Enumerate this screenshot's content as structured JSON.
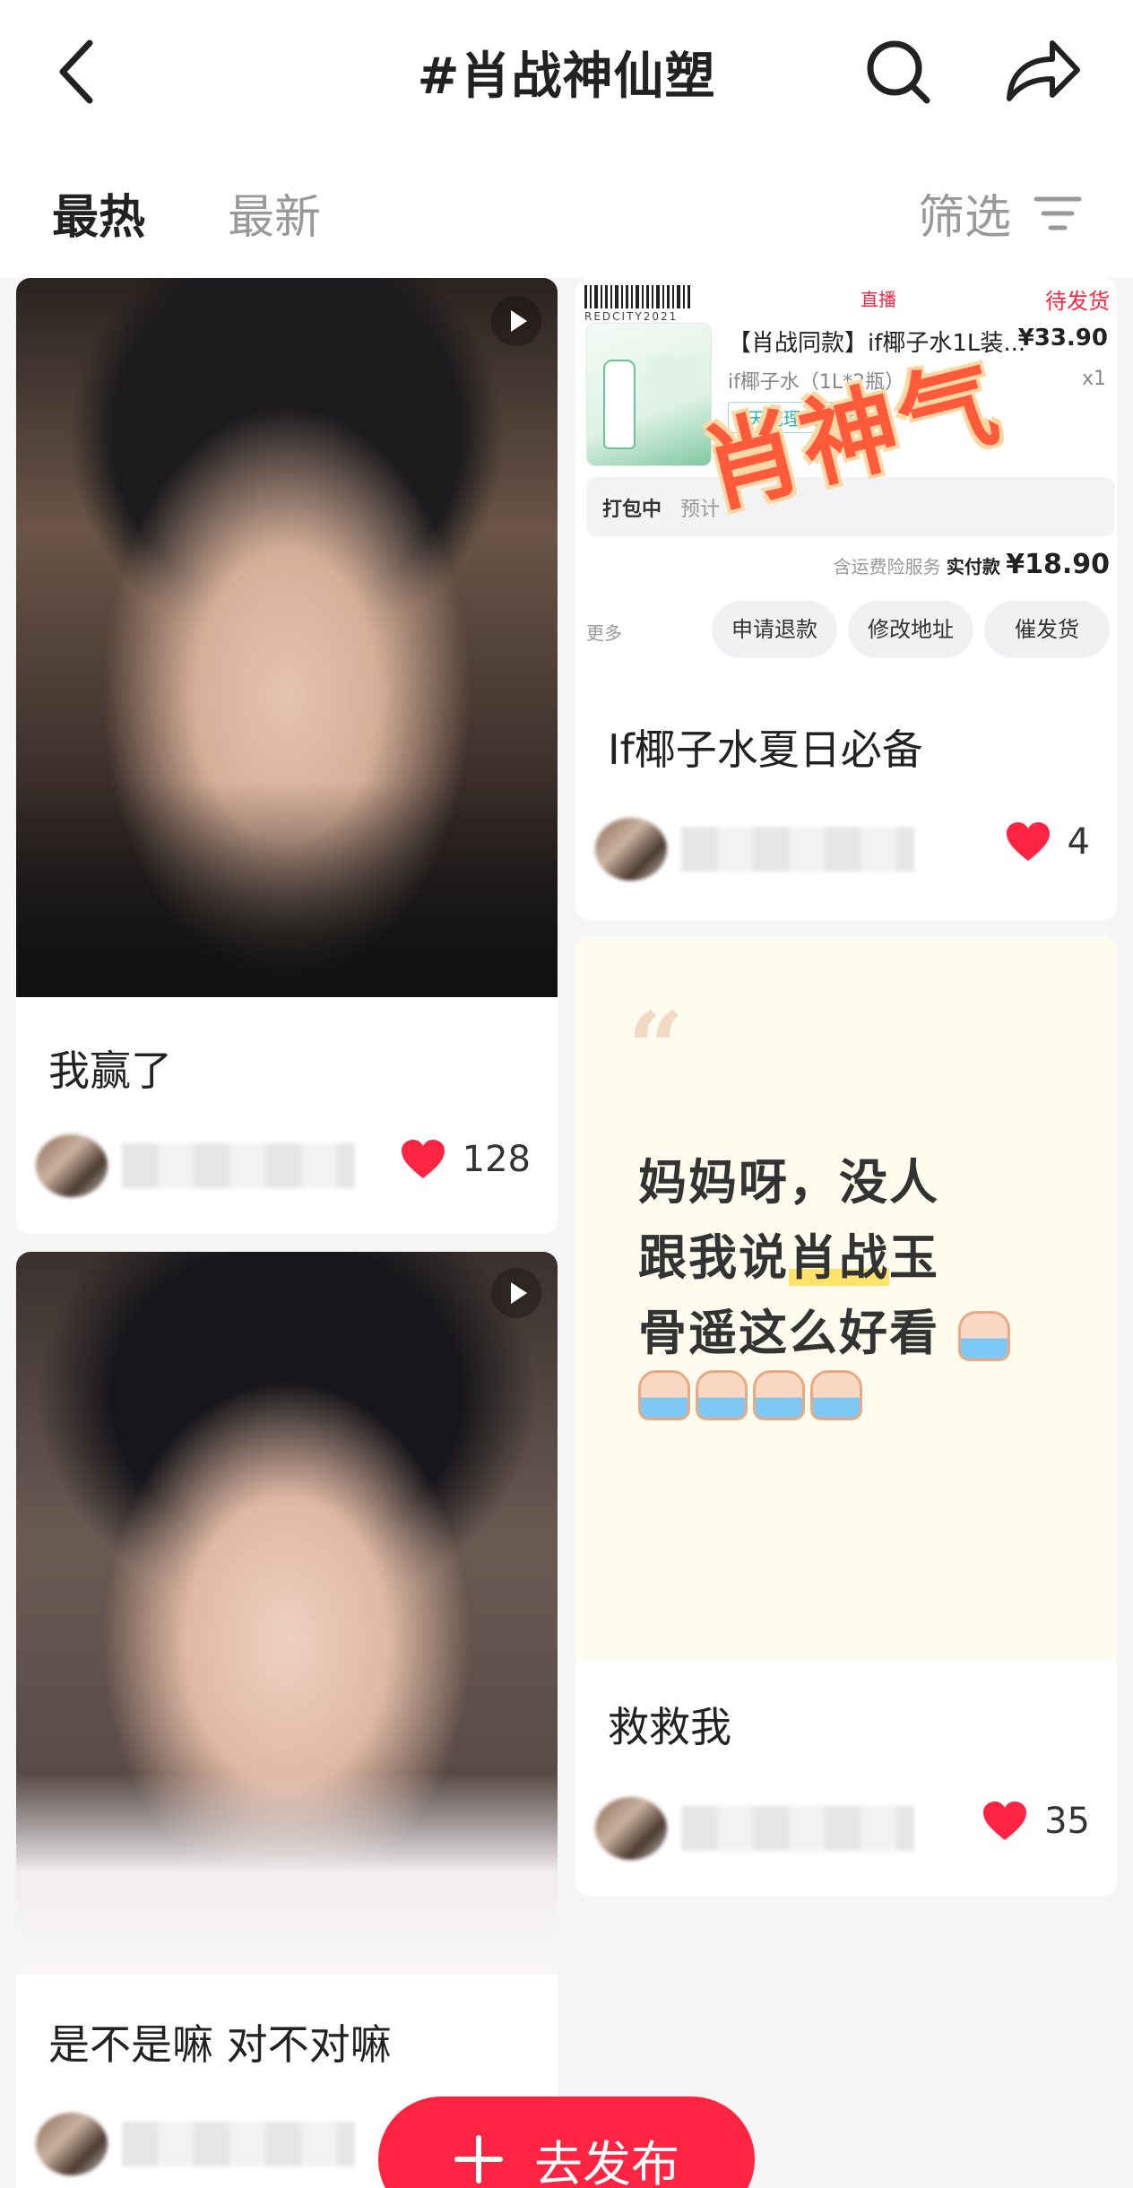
{
  "header": {
    "title": "#肖战神仙塑",
    "tabs": [
      {
        "label": "最热",
        "active": true
      },
      {
        "label": "最新",
        "active": false
      }
    ],
    "filter_label": "筛选"
  },
  "feed": {
    "left": [
      {
        "title": "我赢了",
        "likes": "128",
        "type": "video"
      },
      {
        "title": "是不是嘛 对不对嘛",
        "type": "video"
      }
    ],
    "right": [
      {
        "title": "If椰子水夏日必备",
        "likes": "4",
        "order": {
          "status": "待发货",
          "live_tag": "直播",
          "barcode_text": "REDCITY2021",
          "product": "【肖战同款】if椰子水1L装...",
          "price": "¥33.90",
          "sku": "if椰子水（1L*2瓶）",
          "qty": "x1",
          "tag": "7天无理由退货",
          "pack_label": "打包中",
          "pack_detail": "预计",
          "pay_note": "含运费险服务",
          "pay_label": "实付款",
          "pay_amount": "¥18.90",
          "more": "更多",
          "buttons": [
            "申请退款",
            "修改地址",
            "催发货"
          ],
          "stamp": "肖神气"
        }
      },
      {
        "title": "救救我",
        "likes": "35",
        "quote": {
          "line1": "妈妈呀，没人",
          "line2_pre": "跟我说",
          "line2_hl": "肖战",
          "line2_post": "玉",
          "line3": "骨遥这么好看"
        }
      }
    ]
  },
  "fab": {
    "label": "去发布",
    "icon": "plus-icon"
  },
  "colors": {
    "accent": "#ff2442",
    "background": "#f5f5f5"
  }
}
